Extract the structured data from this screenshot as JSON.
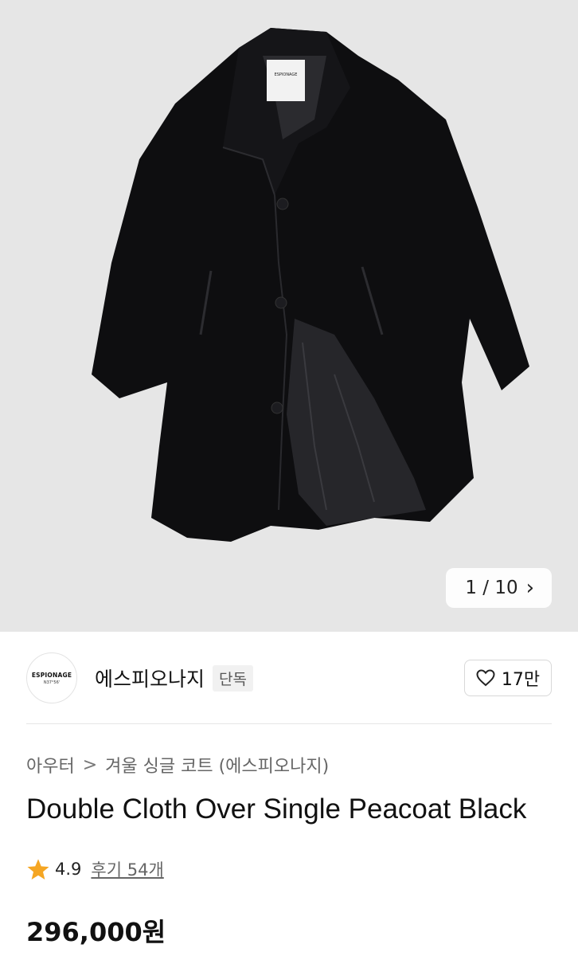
{
  "gallery": {
    "current": "1 / 10",
    "image_alt": "black single peacoat product photo"
  },
  "brand": {
    "logo_line1": "ESPIONAGE",
    "logo_line2": "N37°56'",
    "name": "에스피오나지",
    "badge": "단독",
    "likes": "17만"
  },
  "breadcrumb": {
    "category": "아우터",
    "separator": ">",
    "subcategory": "겨울 싱글 코트 (에스피오나지)"
  },
  "product": {
    "title": "Double Cloth Over Single Peacoat Black",
    "rating": "4.9",
    "reviews": "후기 54개",
    "price": "296,000원"
  },
  "colors": {
    "star": "#f5a623",
    "hero_bg": "#e6e6e6"
  },
  "icons": {
    "next": "chevron-right-icon",
    "like": "heart-icon",
    "rating": "star-icon"
  }
}
